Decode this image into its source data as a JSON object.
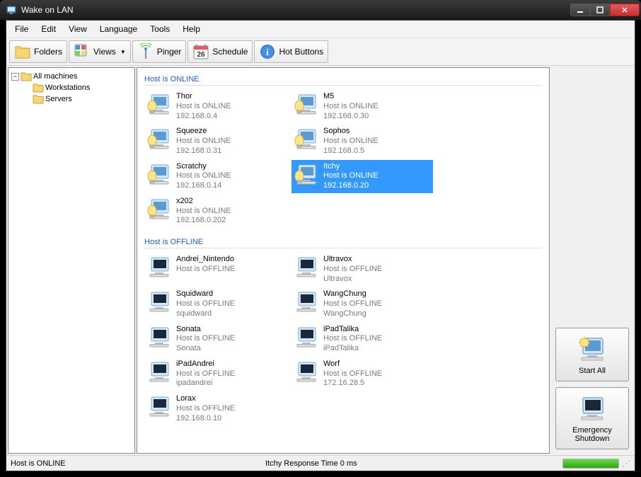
{
  "window": {
    "title": "Wake on LAN"
  },
  "menubar": [
    "File",
    "Edit",
    "View",
    "Language",
    "Tools",
    "Help"
  ],
  "toolbar": {
    "folders": "Folders",
    "views": "Views",
    "pinger": "Pinger",
    "schedule": "Schedule",
    "hotbuttons": "Hot Buttons",
    "schedule_day": "26"
  },
  "tree": {
    "root": "All machines",
    "children": [
      "Workstations",
      "Servers"
    ]
  },
  "groups": {
    "online_label": "Host is ONLINE",
    "offline_label": "Host is OFFLINE"
  },
  "online_hosts": [
    {
      "name": "Thor",
      "status": "Host is ONLINE",
      "ip": "192.168.0.4",
      "selected": false
    },
    {
      "name": "M5",
      "status": "Host is ONLINE",
      "ip": "192.168.0.30",
      "selected": false
    },
    {
      "name": "Squeeze",
      "status": "Host is ONLINE",
      "ip": "192.168.0.31",
      "selected": false
    },
    {
      "name": "Sophos",
      "status": "Host is ONLINE",
      "ip": "192.168.0.5",
      "selected": false
    },
    {
      "name": "Scratchy",
      "status": "Host is ONLINE",
      "ip": "192.168.0.14",
      "selected": false
    },
    {
      "name": "Itchy",
      "status": "Host is ONLINE",
      "ip": "192.168.0.20",
      "selected": true
    },
    {
      "name": "x202",
      "status": "Host is ONLINE",
      "ip": "192.168.0.202",
      "selected": false
    }
  ],
  "offline_hosts": [
    {
      "name": "Andrei_Nintendo",
      "status": "Host is OFFLINE",
      "ip": "",
      "selected": false
    },
    {
      "name": "Ultravox",
      "status": "Host is OFFLINE",
      "ip": "Ultravox",
      "selected": false
    },
    {
      "name": "Squidward",
      "status": "Host is OFFLINE",
      "ip": "squidward",
      "selected": false
    },
    {
      "name": "WangChung",
      "status": "Host is OFFLINE",
      "ip": "WangChung",
      "selected": false
    },
    {
      "name": "Sonata",
      "status": "Host is OFFLINE",
      "ip": "Sonata",
      "selected": false
    },
    {
      "name": "iPadTalika",
      "status": "Host is OFFLINE",
      "ip": "iPadTalika",
      "selected": false
    },
    {
      "name": "iPadAndrei",
      "status": "Host is OFFLINE",
      "ip": "ipadandrei",
      "selected": false
    },
    {
      "name": "Worf",
      "status": "Host is OFFLINE",
      "ip": "172.16.28.5",
      "selected": false
    },
    {
      "name": "Lorax",
      "status": "Host is OFFLINE",
      "ip": "192.168.0.10",
      "selected": false
    }
  ],
  "sidebuttons": {
    "start_all": "Start All",
    "emergency": "Emergency Shutdown"
  },
  "statusbar": {
    "left": "Host is ONLINE",
    "center": "Itchy Response Time 0 ms"
  }
}
